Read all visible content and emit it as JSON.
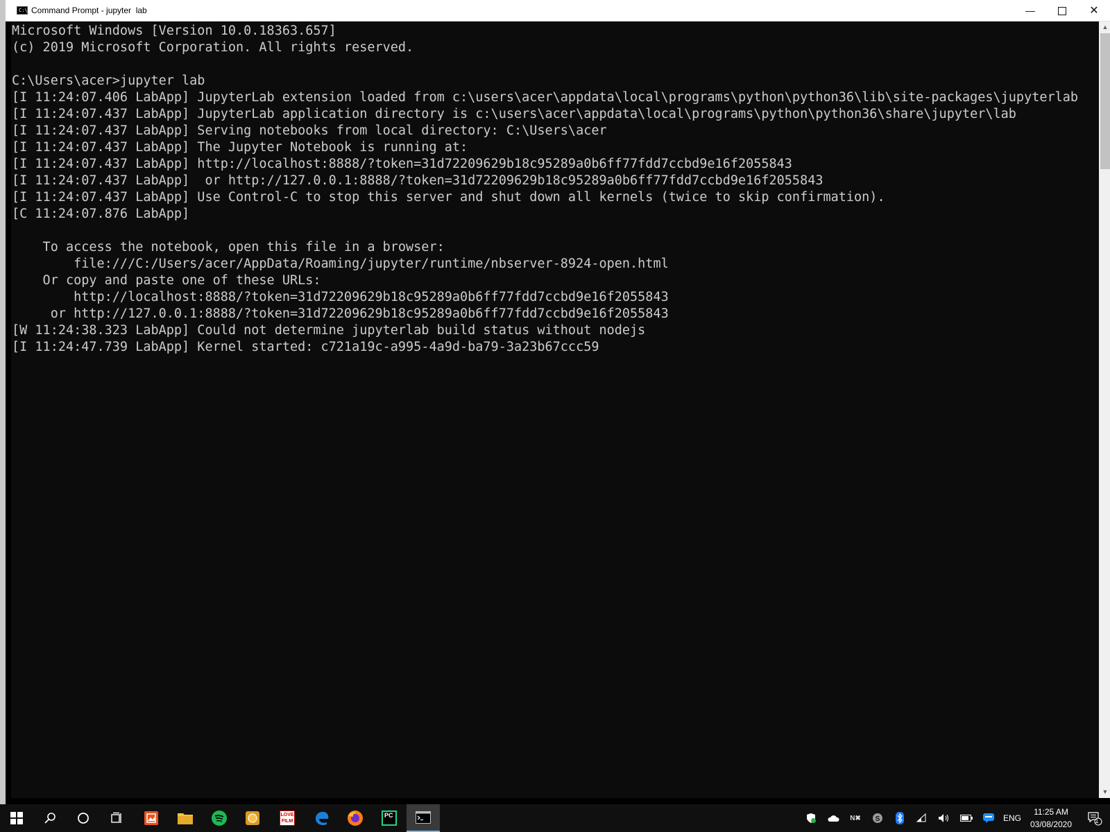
{
  "window": {
    "title": "Command Prompt - jupyter  lab",
    "icon_label": "C:\\",
    "controls": {
      "minimize": "minimize-icon",
      "maximize": "maximize-icon",
      "close": "close-icon"
    }
  },
  "console": {
    "lines": [
      "Microsoft Windows [Version 10.0.18363.657]",
      "(c) 2019 Microsoft Corporation. All rights reserved.",
      "",
      "C:\\Users\\acer>jupyter lab",
      "[I 11:24:07.406 LabApp] JupyterLab extension loaded from c:\\users\\acer\\appdata\\local\\programs\\python\\python36\\lib\\site-packages\\jupyterlab",
      "[I 11:24:07.437 LabApp] JupyterLab application directory is c:\\users\\acer\\appdata\\local\\programs\\python\\python36\\share\\jupyter\\lab",
      "[I 11:24:07.437 LabApp] Serving notebooks from local directory: C:\\Users\\acer",
      "[I 11:24:07.437 LabApp] The Jupyter Notebook is running at:",
      "[I 11:24:07.437 LabApp] http://localhost:8888/?token=31d72209629b18c95289a0b6ff77fdd7ccbd9e16f2055843",
      "[I 11:24:07.437 LabApp]  or http://127.0.0.1:8888/?token=31d72209629b18c95289a0b6ff77fdd7ccbd9e16f2055843",
      "[I 11:24:07.437 LabApp] Use Control-C to stop this server and shut down all kernels (twice to skip confirmation).",
      "[C 11:24:07.876 LabApp]",
      "",
      "    To access the notebook, open this file in a browser:",
      "        file:///C:/Users/acer/AppData/Roaming/jupyter/runtime/nbserver-8924-open.html",
      "    Or copy and paste one of these URLs:",
      "        http://localhost:8888/?token=31d72209629b18c95289a0b6ff77fdd7ccbd9e16f2055843",
      "     or http://127.0.0.1:8888/?token=31d72209629b18c95289a0b6ff77fdd7ccbd9e16f2055843",
      "[W 11:24:38.323 LabApp] Could not determine jupyterlab build status without nodejs",
      "[I 11:24:47.739 LabApp] Kernel started: c721a19c-a995-4a9d-ba79-3a23b67ccc59"
    ]
  },
  "taskbar": {
    "apps": [
      {
        "name": "start-icon"
      },
      {
        "name": "search-icon"
      },
      {
        "name": "cortana-icon"
      },
      {
        "name": "task-view-icon"
      },
      {
        "name": "gallery-app-icon"
      },
      {
        "name": "file-explorer-icon"
      },
      {
        "name": "spotify-icon"
      },
      {
        "name": "coin-app-icon"
      },
      {
        "name": "love-film-icon",
        "label": "LOVE FILM"
      },
      {
        "name": "edge-icon"
      },
      {
        "name": "firefox-icon"
      },
      {
        "name": "pycharm-icon",
        "label": "PC"
      },
      {
        "name": "command-prompt-icon",
        "active": true
      }
    ],
    "tray": {
      "icons": [
        "defender-icon",
        "onedrive-icon",
        "nvidia-icon",
        "skype-icon",
        "bluetooth-icon",
        "wifi-icon",
        "volume-icon",
        "battery-icon",
        "chat-icon"
      ],
      "language": "ENG",
      "time": "11:25 AM",
      "date": "03/08/2020",
      "notification_count": "1"
    }
  },
  "colors": {
    "console_bg": "#0c0c0c",
    "console_fg": "#cccccc",
    "taskbar_bg": "#101010",
    "accent": "#76b9ed"
  }
}
